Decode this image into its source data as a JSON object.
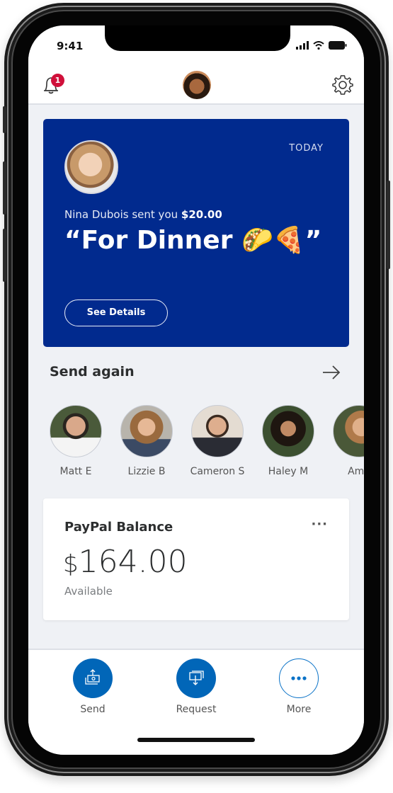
{
  "status_bar": {
    "time": "9:41"
  },
  "top_bar": {
    "notification_count": "1",
    "colors": {
      "badge": "#d0103a"
    }
  },
  "hero_card": {
    "date_label": "TODAY",
    "sender_name": "Nina Dubois",
    "sent_text": " sent you ",
    "amount": "$20.00",
    "note": "“For Dinner 🌮🍕”",
    "button_label": "See Details",
    "colors": {
      "background": "#012a8e"
    }
  },
  "send_again": {
    "title": "Send again",
    "contacts": [
      {
        "name": "Matt E"
      },
      {
        "name": "Lizzie B"
      },
      {
        "name": "Cameron S"
      },
      {
        "name": "Haley M"
      },
      {
        "name": "Ame"
      }
    ]
  },
  "balance_card": {
    "title": "PayPal Balance",
    "menu_label": "···",
    "currency": "$",
    "amount": "164.00",
    "status": "Available"
  },
  "actions": [
    {
      "label": "Send",
      "icon": "send-money-icon"
    },
    {
      "label": "Request",
      "icon": "request-money-icon"
    },
    {
      "label": "More",
      "icon": "more-dots-icon"
    }
  ],
  "colors": {
    "accent": "#0166b8",
    "screen_bg": "#eff1f5"
  }
}
